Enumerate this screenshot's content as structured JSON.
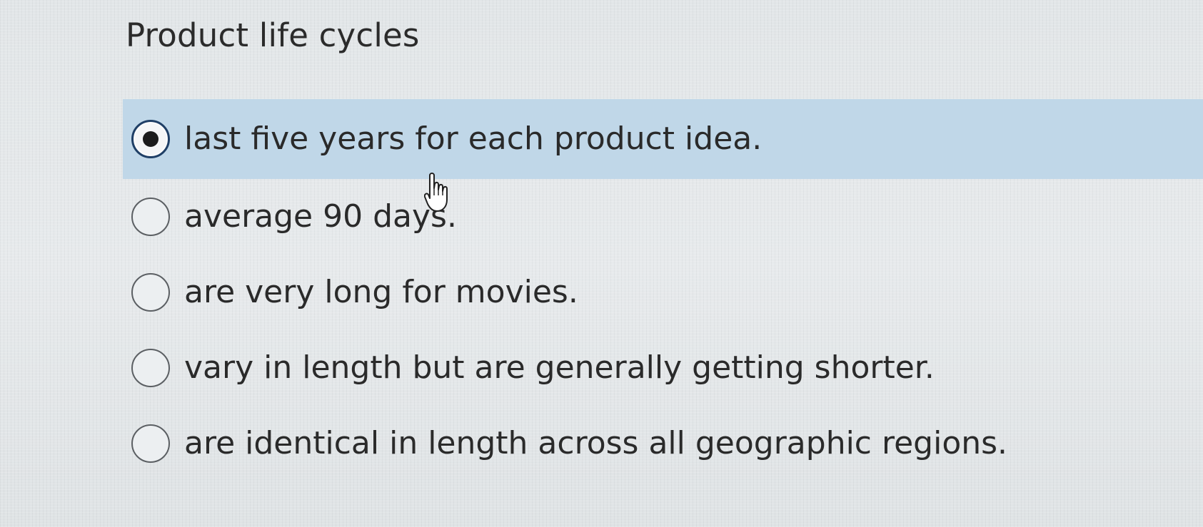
{
  "question": {
    "title": "Product life cycles"
  },
  "options": [
    {
      "label": "last five years for each product idea.",
      "selected": true
    },
    {
      "label": "average 90 days.",
      "selected": false
    },
    {
      "label": "are very long for movies.",
      "selected": false
    },
    {
      "label": "vary in length but are generally getting shorter.",
      "selected": false
    },
    {
      "label": "are identical in length across all geographic regions.",
      "selected": false
    }
  ],
  "colors": {
    "selected_highlight": "#bed6e8",
    "radio_selected_ring": "#1f3f66",
    "text": "#2a2a2a"
  },
  "icons": {
    "cursor": "hand-pointer-icon"
  }
}
